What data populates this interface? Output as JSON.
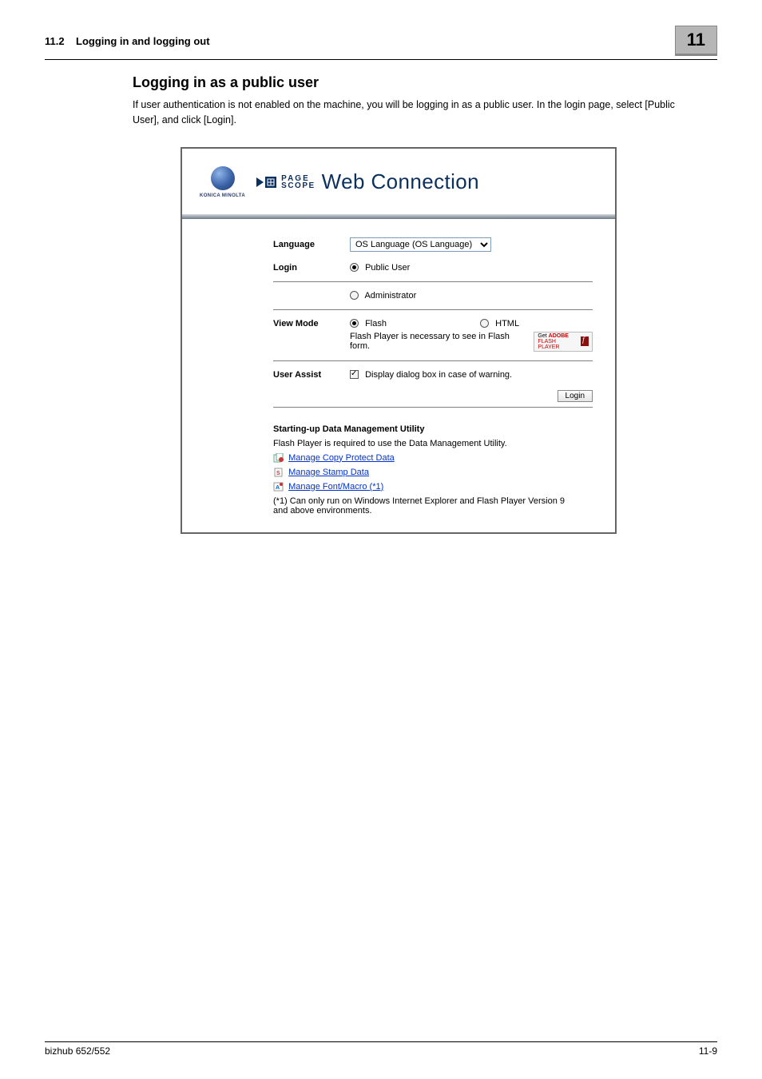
{
  "header": {
    "section_number": "11.2",
    "section_title": "Logging in and logging out",
    "tab": "11"
  },
  "body": {
    "heading": "Logging in as a public user",
    "paragraph": "If user authentication is not enabled on the machine, you will be logging in as a public user. In the login page, select [Public User], and click [Login]."
  },
  "screenshot": {
    "km_logo_text": "KONICA MINOLTA",
    "pagescope_page": "PAGE",
    "pagescope_scope": "SCOPE",
    "webconnection": "Web Connection",
    "labels": {
      "language": "Language",
      "login": "Login",
      "view_mode": "View Mode",
      "user_assist": "User Assist"
    },
    "language_value": "OS Language (OS Language)",
    "login_public": "Public User",
    "login_admin": "Administrator",
    "view_flash": "Flash",
    "view_html": "HTML",
    "flash_note": "Flash Player is necessary to see in Flash form.",
    "adobe_get": "Get",
    "adobe_name": "ADOBE",
    "adobe_flash": "FLASH PLAYER",
    "user_assist_opt": "Display dialog box in case of warning.",
    "login_button": "Login",
    "dm_heading": "Starting-up Data Management Utility",
    "dm_note": "Flash Player is required to use the Data Management Utility.",
    "link1": "Manage Copy Protect Data",
    "link2": "Manage Stamp Data",
    "link3": "Manage Font/Macro (*1)",
    "dm_footnote": "(*1) Can only run on Windows Internet Explorer and Flash Player Version 9 and above environments."
  },
  "footer": {
    "left": "bizhub 652/552",
    "right": "11-9"
  },
  "chart_data": null
}
